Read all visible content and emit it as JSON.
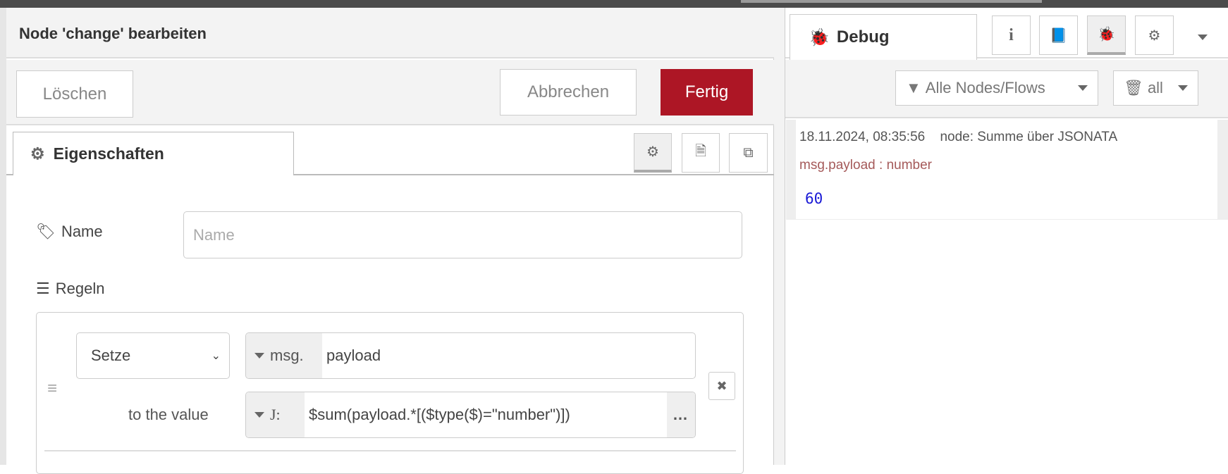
{
  "editor": {
    "title": "Node 'change' bearbeiten",
    "buttons": {
      "delete": "Löschen",
      "cancel": "Abbrechen",
      "done": "Fertig"
    },
    "tab_label": "Eigenschaften",
    "name_label": "Name",
    "name_placeholder": "Name",
    "name_value": "",
    "rules_label": "Regeln",
    "rule": {
      "action": "Setze",
      "target_prefix": "msg.",
      "target": "payload",
      "value_label": "to the value",
      "value_type_icon": "J:",
      "value": "$sum(payload.*[($type($)=\"number\")])",
      "expand_label": "…"
    }
  },
  "sidebar": {
    "tab_label": "Debug",
    "filter_label": "Alle Nodes/Flows",
    "clear_label": "all",
    "message": {
      "timestamp": "18.11.2024, 08:35:56",
      "source": "node: Summe über JSONATA",
      "topic": "msg.payload : number",
      "value": "60"
    }
  },
  "colors": {
    "primary": "#ad1625",
    "topic": "#a55a5a",
    "number": "#1a1ad6"
  }
}
